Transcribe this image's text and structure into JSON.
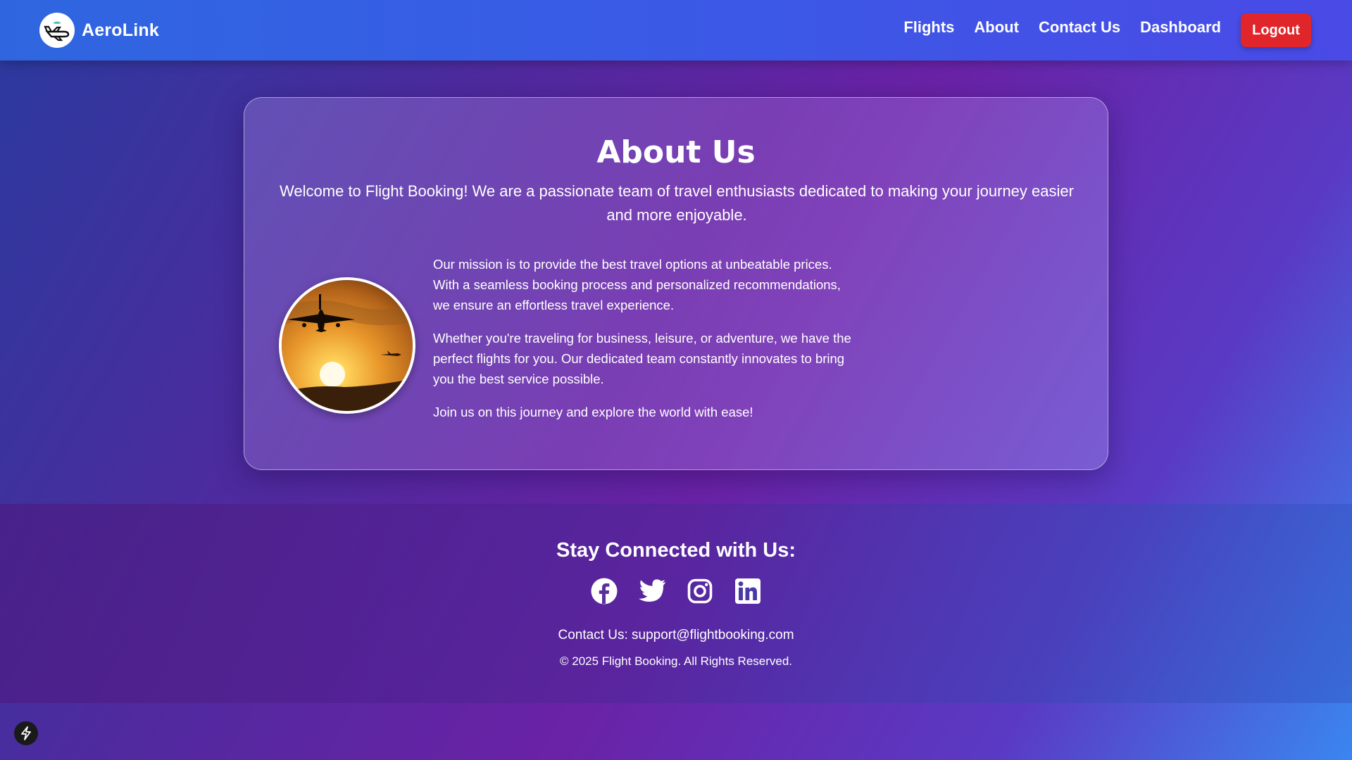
{
  "navbar": {
    "brand": "AeroLink",
    "links": [
      "Flights",
      "About",
      "Contact Us",
      "Dashboard"
    ],
    "logout_label": "Logout"
  },
  "about": {
    "title": "About Us",
    "intro": "Welcome to Flight Booking! We are a passionate team of travel enthusiasts dedicated to making your journey easier and more enjoyable.",
    "paragraphs": [
      "Our mission is to provide the best travel options at unbeatable prices. With a seamless booking process and personalized recommendations, we ensure an effortless travel experience.",
      "Whether you're traveling for business, leisure, or adventure, we have the perfect flights for you. Our dedicated team constantly innovates to bring you the best service possible.",
      "Join us on this journey and explore the world with ease!"
    ]
  },
  "footer": {
    "title": "Stay Connected with Us:",
    "social_icons": [
      "facebook-icon",
      "twitter-icon",
      "instagram-icon",
      "linkedin-icon"
    ],
    "contact": "Contact Us: support@flightbooking.com",
    "copyright": "© 2025 Flight Booking. All Rights Reserved."
  },
  "colors": {
    "nav_start": "#2f66e0",
    "logout": "#e0262b"
  }
}
